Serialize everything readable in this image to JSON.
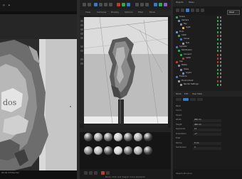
{
  "colors": {
    "accent_red": "#c0392b",
    "accent_green": "#2fa84f",
    "accent_blue": "#3a78c3",
    "panel_bg": "#1d1d1d"
  },
  "render_view": {
    "status": "00:01:23  Render"
  },
  "viewport": {
    "tabs": [
      "View",
      "Cameras",
      "Display",
      "Options",
      "Filter",
      "Panel"
    ]
  },
  "object_manager": {
    "tabs": [
      "Objects",
      "Takes"
    ],
    "panel_button": "Panel",
    "rows": [
      {
        "label": "Scene",
        "icon": "#2fa84f",
        "flag": "#2fa84f"
      },
      {
        "label": "Camera",
        "icon": "#6f8fb3",
        "flag": "#2fa84f"
      },
      {
        "label": "Sky",
        "icon": "#6f8fb3",
        "flag": "#2fa84f"
      },
      {
        "label": "Light",
        "icon": "#d6b656",
        "flag": "#2fa84f"
      },
      {
        "label": "Floor",
        "icon": "#6f8fb3",
        "flag": "#2fa84f"
      },
      {
        "label": "Cloth",
        "icon": "#2fa84f",
        "flag": "#c0392b"
      },
      {
        "label": "Cloner",
        "icon": "#3a78c3",
        "flag": "#2fa84f"
      },
      {
        "label": "Null",
        "icon": "#9a9a9a",
        "flag": "#2fa84f"
      },
      {
        "label": "Cylinder",
        "icon": "#3a78c3",
        "flag": "#2fa84f"
      },
      {
        "label": "Subdivision",
        "icon": "#2fa84f",
        "flag": "#2fa84f"
      },
      {
        "label": "Connect",
        "icon": "#2fa84f",
        "flag": "#c0392b"
      },
      {
        "label": "Label",
        "icon": "#c0392b",
        "flag": "#c0392b"
      },
      {
        "label": "Cap",
        "icon": "#c0392b",
        "flag": "#c0392b"
      },
      {
        "label": "Bottle",
        "icon": "#6f8fb3",
        "flag": "#2fa84f"
      },
      {
        "label": "Glass",
        "icon": "#6f8fb3",
        "flag": "#2fa84f"
      },
      {
        "label": "Liquid",
        "icon": "#6f8fb3",
        "flag": "#2fa84f"
      },
      {
        "label": "Fracture",
        "icon": "#3a78c3",
        "flag": "#c0392b"
      },
      {
        "label": "Environment",
        "icon": "#9a9a9a",
        "flag": "#c0392b"
      },
      {
        "label": "Render Settings",
        "icon": "#9a9a9a",
        "flag": "#2fa84f"
      }
    ]
  },
  "attribute_manager": {
    "tabs": [
      "Mode",
      "Edit",
      "User Data"
    ],
    "rows": [
      {
        "key": "Basic",
        "value": ""
      },
      {
        "key": "Coord.",
        "value": ""
      },
      {
        "key": "Object",
        "value": ""
      },
      {
        "key": "Width",
        "value": "200 cm"
      },
      {
        "key": "Height",
        "value": "400 cm"
      },
      {
        "key": "Segments",
        "value": "12"
      },
      {
        "key": "Orientation",
        "value": "+Y"
      },
      {
        "key": "Fillet",
        "value": ""
      },
      {
        "key": "Radius",
        "value": "5 cm"
      },
      {
        "key": "Subdivision",
        "value": "3"
      }
    ],
    "bottom": "Objects  Structure"
  },
  "materials": [
    "Mat",
    "Mat.1",
    "Mat.2",
    "Mat.3",
    "Mat.4",
    "Mat.5",
    "Mat.6",
    "Mat.7",
    "Mat.8",
    "Mat.9",
    "Mat.10",
    "Mat.11",
    "Mat.12",
    "Mat.13"
  ],
  "bottom_status": "Move: Click and drag to move elements"
}
